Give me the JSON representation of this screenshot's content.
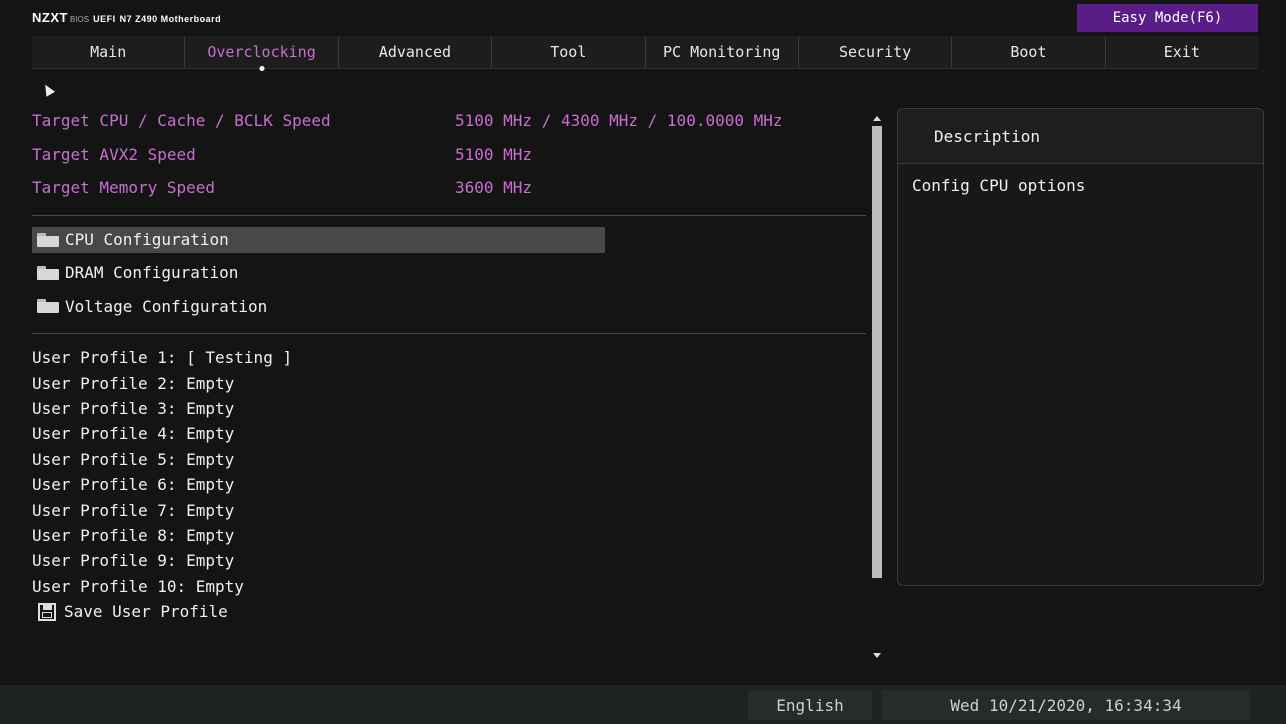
{
  "header": {
    "brand": "NZXT",
    "bios_label": "BIOS",
    "uefi_label": "UEFI",
    "model": "N7 Z490 Motherboard",
    "easy_mode": "Easy Mode(F6)"
  },
  "tabs": [
    {
      "label": "Main",
      "active": false
    },
    {
      "label": "Overclocking",
      "active": true
    },
    {
      "label": "Advanced",
      "active": false
    },
    {
      "label": "Tool",
      "active": false
    },
    {
      "label": "PC Monitoring",
      "active": false
    },
    {
      "label": "Security",
      "active": false
    },
    {
      "label": "Boot",
      "active": false
    },
    {
      "label": "Exit",
      "active": false
    }
  ],
  "info": [
    {
      "label": "Target CPU / Cache / BCLK Speed",
      "value": "5100 MHz / 4300 MHz / 100.0000 MHz"
    },
    {
      "label": "Target AVX2 Speed",
      "value": "5100 MHz"
    },
    {
      "label": "Target Memory Speed",
      "value": "3600 MHz"
    }
  ],
  "menu": [
    {
      "label": "CPU Configuration",
      "icon": "folder-icon",
      "selected": true
    },
    {
      "label": "DRAM Configuration",
      "icon": "folder-icon",
      "selected": false
    },
    {
      "label": "Voltage Configuration",
      "icon": "folder-icon",
      "selected": false
    }
  ],
  "profiles": [
    "User Profile 1: [ Testing ]",
    "User Profile 2: Empty",
    "User Profile 3: Empty",
    "User Profile 4: Empty",
    "User Profile 5: Empty",
    "User Profile 6: Empty",
    "User Profile 7: Empty",
    "User Profile 8: Empty",
    "User Profile 9: Empty",
    "User Profile 10: Empty"
  ],
  "save_profile": {
    "label": "Save User Profile",
    "icon": "floppy-icon"
  },
  "description": {
    "title": "Description",
    "text": "Config CPU options"
  },
  "status": {
    "language": "English",
    "datetime": "Wed 10/21/2020, 16:34:34"
  },
  "colors": {
    "accent": "#c86ed0",
    "easy_mode_bg": "#5a1c86",
    "background": "#141414"
  }
}
